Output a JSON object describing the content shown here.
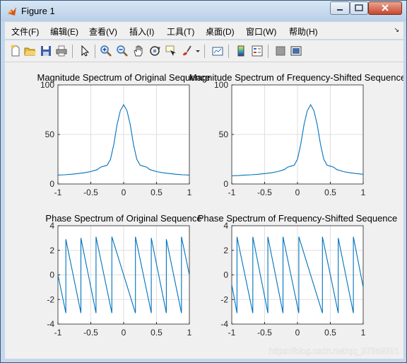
{
  "window": {
    "title": "Figure 1"
  },
  "menu": {
    "items": [
      "文件(F)",
      "编辑(E)",
      "查看(V)",
      "插入(I)",
      "工具(T)",
      "桌面(D)",
      "窗口(W)",
      "帮助(H)"
    ]
  },
  "toolbar": {
    "buttons": [
      "new-file-icon",
      "open-folder-icon",
      "save-icon",
      "print-icon",
      "pointer-icon",
      "zoom-in-icon",
      "zoom-out-icon",
      "pan-hand-icon",
      "rotate-3d-icon",
      "data-cursor-icon",
      "brush-icon",
      "brush-dropdown-icon",
      "link-plot-icon",
      "colorbar-icon",
      "legend-icon",
      "hide-plot-tools-icon",
      "show-plot-tools-icon"
    ]
  },
  "colors": {
    "line": "#0072bd",
    "grid": "#dfdfdf",
    "axis": "#262626"
  },
  "watermark": "https://blog.csdn.net/qq_37369201",
  "chart_data": [
    {
      "type": "line",
      "title": "Magnitude Spectrum of Original Sequence",
      "xlabel": "",
      "ylabel": "",
      "xlim": [
        -1,
        1
      ],
      "ylim": [
        0,
        100
      ],
      "xticks": [
        "-1",
        "-0.5",
        "0",
        "0.5",
        "1"
      ],
      "yticks": [
        "0",
        "50",
        "100"
      ],
      "grid": true,
      "series": [
        {
          "x": [
            -1,
            -0.9,
            -0.8,
            -0.7,
            -0.6,
            -0.5,
            -0.4,
            -0.35,
            -0.3,
            -0.25,
            -0.2,
            -0.15,
            -0.1,
            -0.05,
            0,
            0.05,
            0.1,
            0.15,
            0.2,
            0.25,
            0.3,
            0.35,
            0.4,
            0.5,
            0.6,
            0.7,
            0.8,
            0.9,
            1
          ],
          "y": [
            9,
            9.3,
            9.8,
            10.5,
            11.3,
            12.5,
            14.5,
            17,
            18,
            19,
            25,
            40,
            60,
            74,
            80,
            74,
            60,
            40,
            25,
            19,
            18,
            17,
            14.5,
            12.5,
            11.3,
            10.5,
            9.8,
            9.3,
            9
          ]
        }
      ]
    },
    {
      "type": "line",
      "title": "Magnitude Spectrum of Frequency-Shifted Sequence",
      "xlabel": "",
      "ylabel": "",
      "xlim": [
        -1,
        1
      ],
      "ylim": [
        0,
        100
      ],
      "xticks": [
        "-1",
        "-0.5",
        "0",
        "0.5",
        "1"
      ],
      "yticks": [
        "0",
        "50",
        "100"
      ],
      "grid": true,
      "series": [
        {
          "x": [
            -1,
            -0.9,
            -0.8,
            -0.7,
            -0.6,
            -0.5,
            -0.4,
            -0.3,
            -0.2,
            -0.15,
            -0.1,
            -0.05,
            0,
            0.05,
            0.1,
            0.15,
            0.2,
            0.25,
            0.3,
            0.35,
            0.4,
            0.45,
            0.5,
            0.55,
            0.6,
            0.7,
            0.8,
            0.9,
            1
          ],
          "y": [
            8.2,
            8.5,
            9,
            9.3,
            9.8,
            10.5,
            11.3,
            12.5,
            14.5,
            17,
            18,
            19,
            25,
            40,
            60,
            74,
            80,
            74,
            60,
            40,
            25,
            19,
            18,
            17,
            14.5,
            12.5,
            11.3,
            10.5,
            9.8
          ]
        }
      ]
    },
    {
      "type": "line",
      "title": "Phase Spectrum of Original Sequence",
      "xlabel": "",
      "ylabel": "",
      "xlim": [
        -1,
        1
      ],
      "ylim": [
        -4,
        4
      ],
      "xticks": [
        "-1",
        "-0.5",
        "0",
        "0.5",
        "1"
      ],
      "yticks": [
        "-4",
        "-2",
        "0",
        "2",
        "4"
      ],
      "grid": true,
      "series": [
        {
          "x": [
            -1,
            -0.88,
            -0.88,
            -0.65,
            -0.65,
            -0.42,
            -0.42,
            -0.18,
            -0.18,
            0.18,
            0.18,
            0.42,
            0.42,
            0.65,
            0.65,
            0.88,
            0.88,
            1
          ],
          "y": [
            0,
            -3.1,
            2.9,
            -3.1,
            3.0,
            -3.1,
            3.1,
            -3.1,
            3.1,
            -3.1,
            3.1,
            -3.1,
            3.0,
            -3.1,
            2.9,
            -3.1,
            3.1,
            0
          ]
        }
      ]
    },
    {
      "type": "line",
      "title": "Phase Spectrum of Frequency-Shifted Sequence",
      "xlabel": "",
      "ylabel": "",
      "xlim": [
        -1,
        1
      ],
      "ylim": [
        -4,
        4
      ],
      "xticks": [
        "-1",
        "-0.5",
        "0",
        "0.5",
        "1"
      ],
      "yticks": [
        "-4",
        "-2",
        "0",
        "2",
        "4"
      ],
      "grid": true,
      "series": [
        {
          "x": [
            -1,
            -0.92,
            -0.92,
            -0.68,
            -0.68,
            -0.45,
            -0.45,
            -0.22,
            -0.22,
            0.02,
            0.02,
            0.38,
            0.38,
            0.62,
            0.62,
            0.85,
            0.85,
            1
          ],
          "y": [
            -0.8,
            -3.1,
            3.1,
            -3.1,
            3.1,
            -3.1,
            3.1,
            -3.1,
            3.1,
            -3.1,
            3.1,
            -3.1,
            3.1,
            -3.1,
            3.0,
            -3.1,
            3.1,
            -1.0
          ]
        }
      ]
    }
  ]
}
